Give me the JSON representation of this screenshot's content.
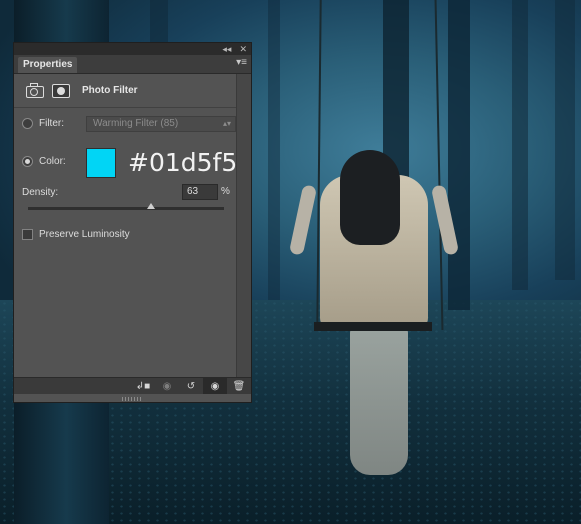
{
  "panel": {
    "tab_label": "Properties",
    "collapse_glyph": "◂◂",
    "close_glyph": "✕",
    "menu_glyph": "▾≡",
    "adjustment_title": "Photo Filter",
    "filter": {
      "label": "Filter:",
      "value": "Warming Filter (85)",
      "selected": false
    },
    "color": {
      "label": "Color:",
      "selected": true,
      "swatch": "#01d5f5",
      "hex": "#01d5f5"
    },
    "density": {
      "label": "Density:",
      "value": "63",
      "unit": "%",
      "level": 0.63
    },
    "preserve_luminosity": {
      "label": "Preserve Luminosity",
      "checked": false
    },
    "footer_icons": [
      "clip-to-layer-icon",
      "view-previous-state-icon",
      "reset-icon",
      "visibility-eye-icon",
      "trash-icon"
    ]
  },
  "colors": {
    "panel_bg": "#535353",
    "accent_swatch": "#01d5f5"
  }
}
